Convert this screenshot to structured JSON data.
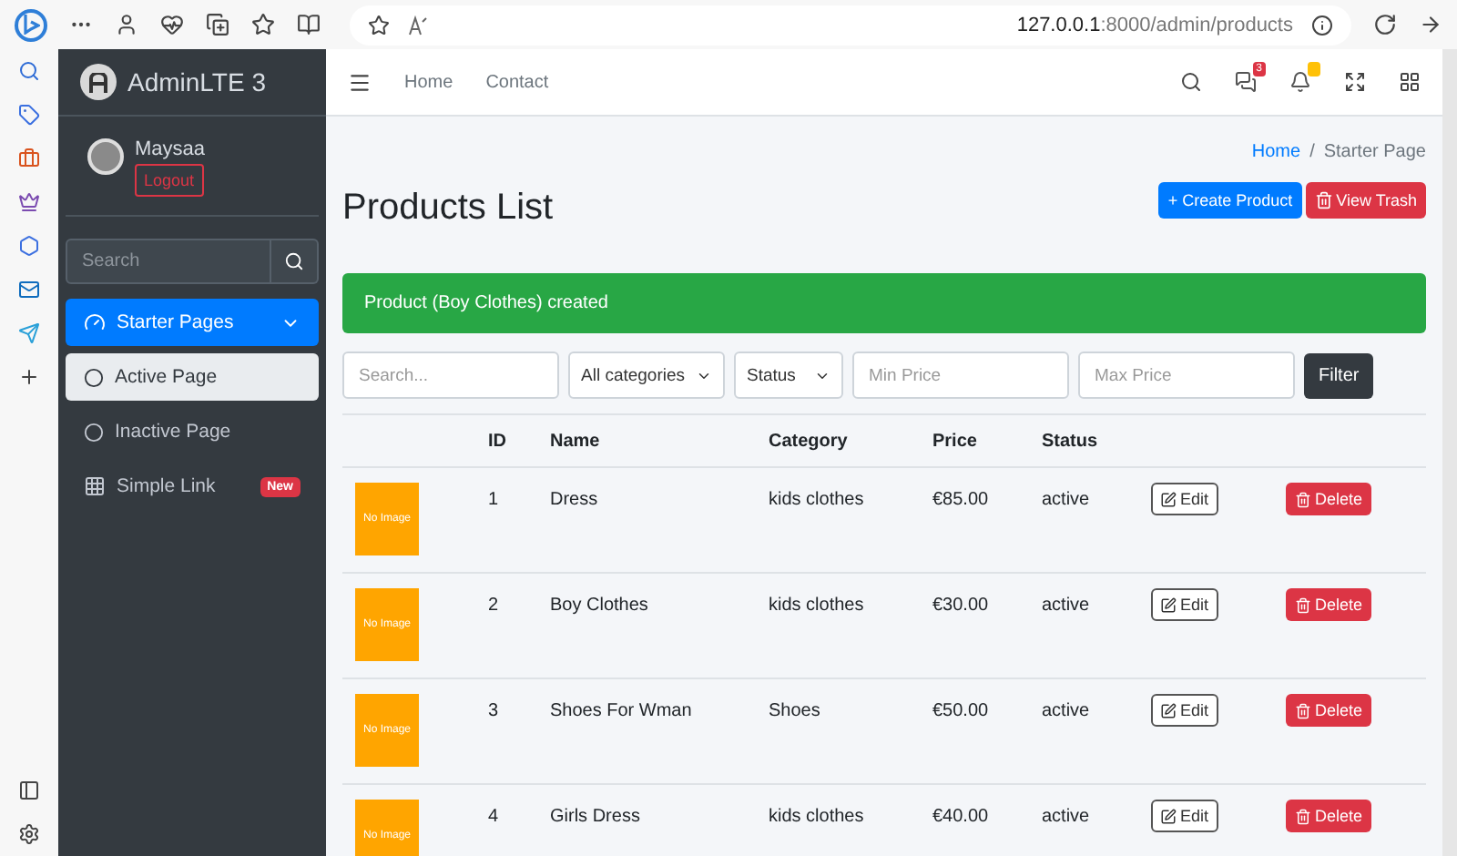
{
  "browser": {
    "url_host": "127.0.0.1",
    "url_path": ":8000/admin/products"
  },
  "brand": {
    "title": "AdminLTE 3"
  },
  "user": {
    "name": "Maysaa",
    "logout": "Logout"
  },
  "sidebar": {
    "search": {
      "placeholder": "Search"
    },
    "items": [
      {
        "label": "Starter Pages",
        "kind": "group",
        "selected": true,
        "expanded": true,
        "children": [
          {
            "label": "Active Page",
            "kind": "page",
            "selected": true
          },
          {
            "label": "Inactive Page",
            "kind": "page",
            "selected": false
          }
        ]
      },
      {
        "label": "Simple Link",
        "kind": "link",
        "selected": false,
        "badge": "New"
      }
    ]
  },
  "navbar": {
    "links": [
      "Home",
      "Contact"
    ],
    "message_count": "3"
  },
  "breadcrumb": {
    "home": "Home",
    "separator": "/",
    "current": "Starter Page"
  },
  "page": {
    "title": "Products List",
    "create_button": "+ Create Product",
    "trash_button": "View Trash"
  },
  "alert": {
    "text": "Product (Boy Clothes) created"
  },
  "filters": {
    "search": {
      "placeholder": "Search..."
    },
    "category": "All categories",
    "status": "Status",
    "min_price": {
      "placeholder": "Min Price"
    },
    "max_price": {
      "placeholder": "Max Price"
    },
    "button": "Filter"
  },
  "table": {
    "columns": [
      "ID",
      "Name",
      "Category",
      "Price",
      "Status"
    ],
    "rows": [
      {
        "image": "No Image",
        "id": "1",
        "name": "Dress",
        "category": "kids clothes",
        "price": "€85.00",
        "status": "active",
        "edit": "Edit",
        "delete": "Delete"
      },
      {
        "image": "No Image",
        "id": "2",
        "name": "Boy Clothes",
        "category": "kids clothes",
        "price": "€30.00",
        "status": "active",
        "edit": "Edit",
        "delete": "Delete"
      },
      {
        "image": "No Image",
        "id": "3",
        "name": "Shoes For Wman",
        "category": "Shoes",
        "price": "€50.00",
        "status": "active",
        "edit": "Edit",
        "delete": "Delete"
      },
      {
        "image": "No Image",
        "id": "4",
        "name": "Girls Dress",
        "category": "kids clothes",
        "price": "€40.00",
        "status": "active",
        "edit": "Edit",
        "delete": "Delete"
      }
    ]
  }
}
